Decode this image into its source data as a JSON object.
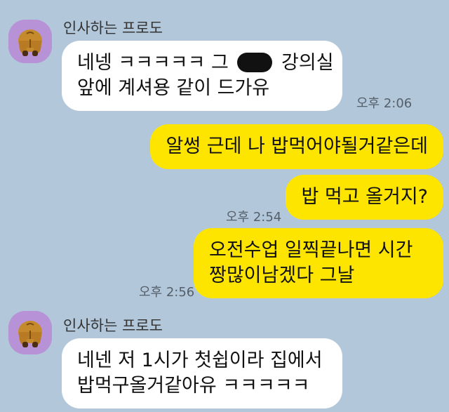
{
  "messages": [
    {
      "sender": "인사하는 프로도",
      "line1_before": "네넹 ㅋㅋㅋㅋㅋ 그 ",
      "line1_after": " 강의실",
      "line2": "앞에 계셔용 같이 드가유",
      "time": "오후 2:06"
    },
    {
      "text": "알썽 근데 나 밥먹어야될거같은데"
    },
    {
      "text": "밥 먹고 올거지?",
      "time": "오후 2:54"
    },
    {
      "text": "오전수업 일찍끝나면 시간\n짱많이남겠다 그날",
      "time": "오후 2:56"
    },
    {
      "sender": "인사하는 프로도",
      "text": "네넨 저 1시가 첫쉽이라 집에서\n밥먹구올거같아유 ㅋㅋㅋㅋㅋ"
    }
  ],
  "colors": {
    "background": "#b2c7da",
    "incoming_bubble": "#ffffff",
    "outgoing_bubble": "#fee500",
    "avatar_bg": "#b892d6"
  },
  "icons": {
    "avatar": "frodo-avatar-icon",
    "redaction": "redacted-text-blob"
  }
}
